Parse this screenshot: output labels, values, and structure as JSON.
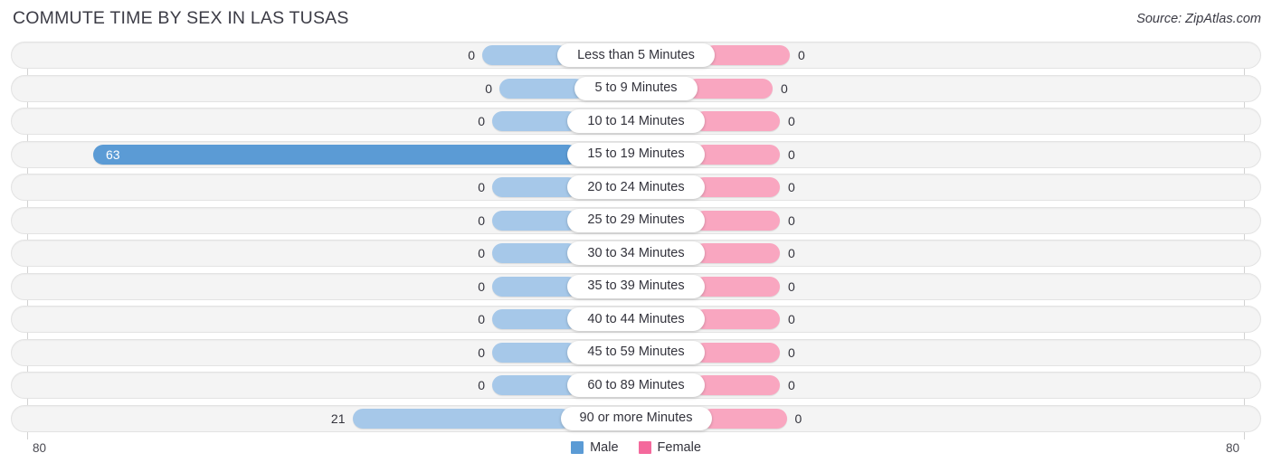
{
  "header": {
    "title": "COMMUTE TIME BY SEX IN LAS TUSAS",
    "source": "Source: ZipAtlas.com"
  },
  "legend": {
    "male_label": "Male",
    "female_label": "Female",
    "male_color": "#5b9bd5",
    "female_color": "#f4699c"
  },
  "axis": {
    "left_tick": "80",
    "right_tick": "80"
  },
  "colors": {
    "bar_male": "#a6c8e9",
    "bar_male_highlight": "#5b9bd5",
    "bar_female": "#f9a6c0",
    "track": "#f4f4f4"
  },
  "chart_data": {
    "type": "bar",
    "orientation": "horizontal-diverging",
    "title": "COMMUTE TIME BY SEX IN LAS TUSAS",
    "xlabel": "",
    "ylabel": "",
    "xlim": [
      80,
      80
    ],
    "grid": false,
    "legend_position": "bottom-center",
    "categories": [
      "Less than 5 Minutes",
      "5 to 9 Minutes",
      "10 to 14 Minutes",
      "15 to 19 Minutes",
      "20 to 24 Minutes",
      "25 to 29 Minutes",
      "30 to 34 Minutes",
      "35 to 39 Minutes",
      "40 to 44 Minutes",
      "45 to 59 Minutes",
      "60 to 89 Minutes",
      "90 or more Minutes"
    ],
    "series": [
      {
        "name": "Male",
        "values": [
          0,
          0,
          0,
          63,
          0,
          0,
          0,
          0,
          0,
          0,
          0,
          21
        ]
      },
      {
        "name": "Female",
        "values": [
          0,
          0,
          0,
          0,
          0,
          0,
          0,
          0,
          0,
          0,
          0,
          0
        ]
      }
    ]
  },
  "rows": [
    {
      "label": "Less than 5 Minutes",
      "male": "0",
      "female": "0",
      "male_len": 0,
      "female_len": 0,
      "highlight": false
    },
    {
      "label": "5 to 9 Minutes",
      "male": "0",
      "female": "0",
      "male_len": 0,
      "female_len": 0,
      "highlight": false
    },
    {
      "label": "10 to 14 Minutes",
      "male": "0",
      "female": "0",
      "male_len": 0,
      "female_len": 0,
      "highlight": false
    },
    {
      "label": "15 to 19 Minutes",
      "male": "63",
      "female": "0",
      "male_len": 63,
      "female_len": 0,
      "highlight": true
    },
    {
      "label": "20 to 24 Minutes",
      "male": "0",
      "female": "0",
      "male_len": 0,
      "female_len": 0,
      "highlight": false
    },
    {
      "label": "25 to 29 Minutes",
      "male": "0",
      "female": "0",
      "male_len": 0,
      "female_len": 0,
      "highlight": false
    },
    {
      "label": "30 to 34 Minutes",
      "male": "0",
      "female": "0",
      "male_len": 0,
      "female_len": 0,
      "highlight": false
    },
    {
      "label": "35 to 39 Minutes",
      "male": "0",
      "female": "0",
      "male_len": 0,
      "female_len": 0,
      "highlight": false
    },
    {
      "label": "40 to 44 Minutes",
      "male": "0",
      "female": "0",
      "male_len": 0,
      "female_len": 0,
      "highlight": false
    },
    {
      "label": "45 to 59 Minutes",
      "male": "0",
      "female": "0",
      "male_len": 0,
      "female_len": 0,
      "highlight": false
    },
    {
      "label": "60 to 89 Minutes",
      "male": "0",
      "female": "0",
      "male_len": 0,
      "female_len": 0,
      "highlight": false
    },
    {
      "label": "90 or more Minutes",
      "male": "21",
      "female": "0",
      "male_len": 21,
      "female_len": 0,
      "highlight": false
    }
  ]
}
